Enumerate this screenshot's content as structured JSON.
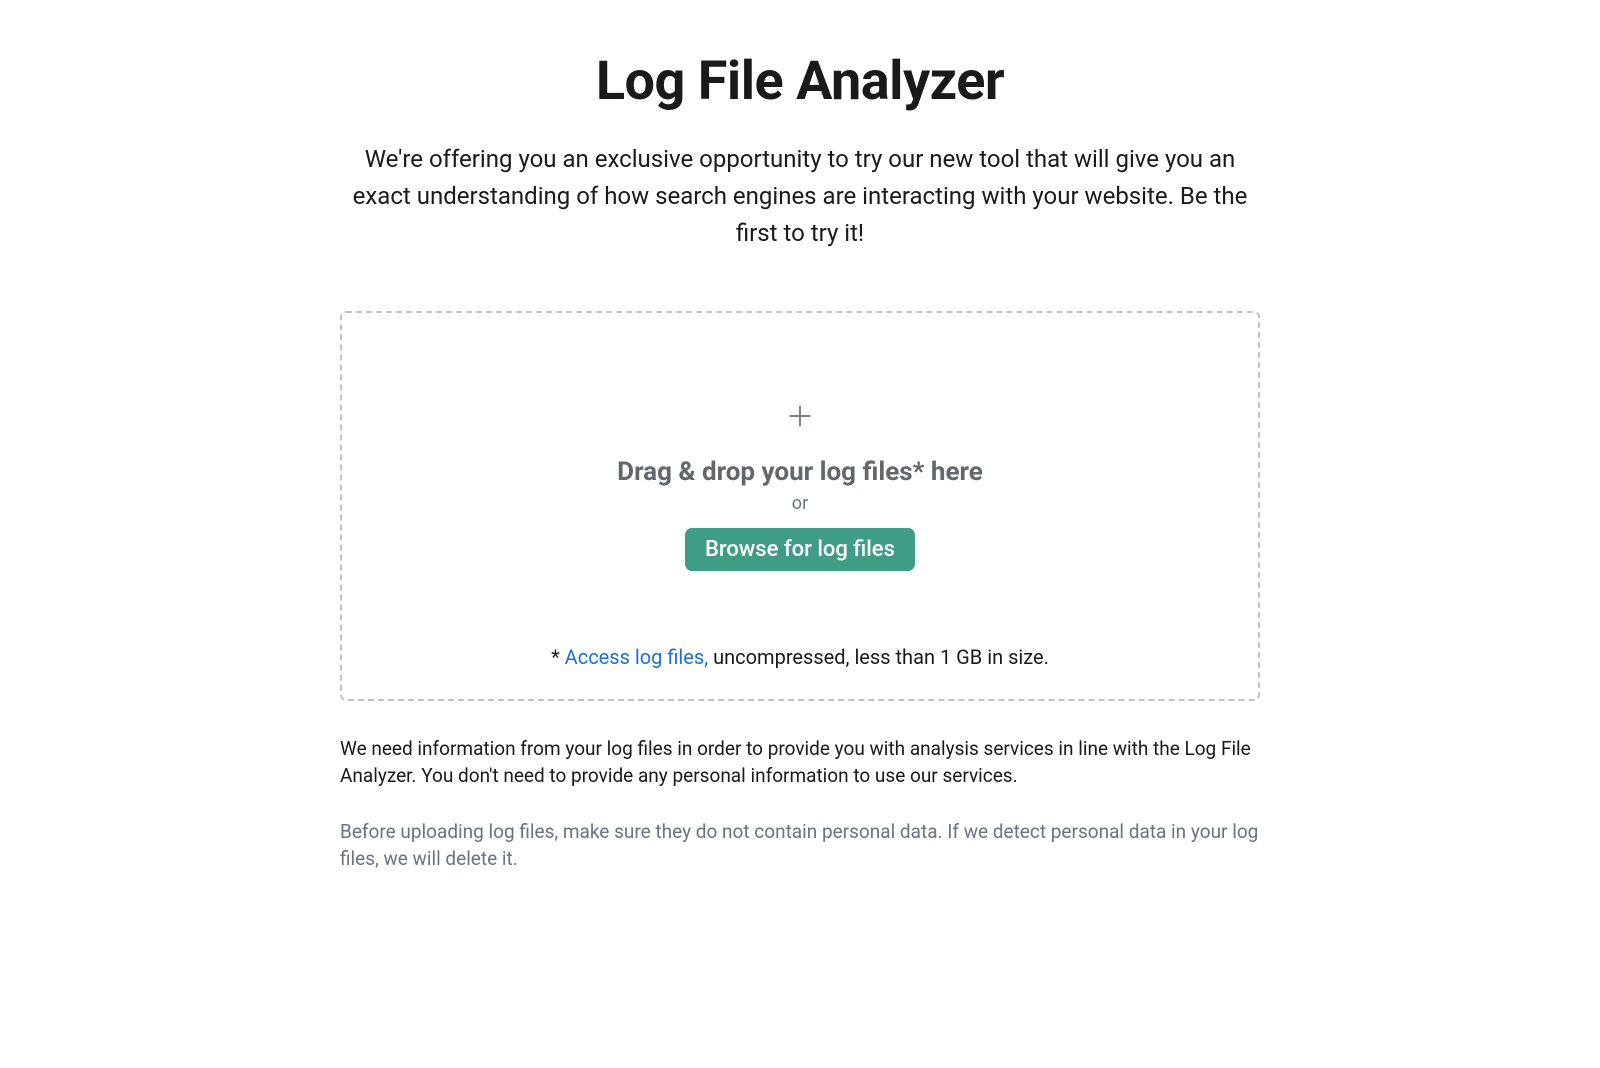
{
  "header": {
    "title": "Log File Analyzer",
    "subtitle": "We're offering you an exclusive opportunity to try our new tool that will give you an exact understanding of how search engines are interacting with your website. Be the first to try it!"
  },
  "dropzone": {
    "heading": "Drag & drop your log files* here",
    "or_text": "or",
    "browse_label": "Browse for log files",
    "footnote_prefix": "* ",
    "footnote_link": "Access log files,",
    "footnote_suffix": " uncompressed, less than 1 GB in size."
  },
  "disclaimer": {
    "primary": "We need information from your log files in order to provide you with analysis services in line with the Log File Analyzer. You don't need to provide any personal information to use our services.",
    "secondary": "Before uploading log files, make sure they do not contain personal data. If we detect personal data in your log files, we will delete it."
  },
  "colors": {
    "accent": "#3f9d85",
    "link": "#1d6fdc",
    "muted": "#6b7280",
    "border": "#bfc3c9"
  }
}
